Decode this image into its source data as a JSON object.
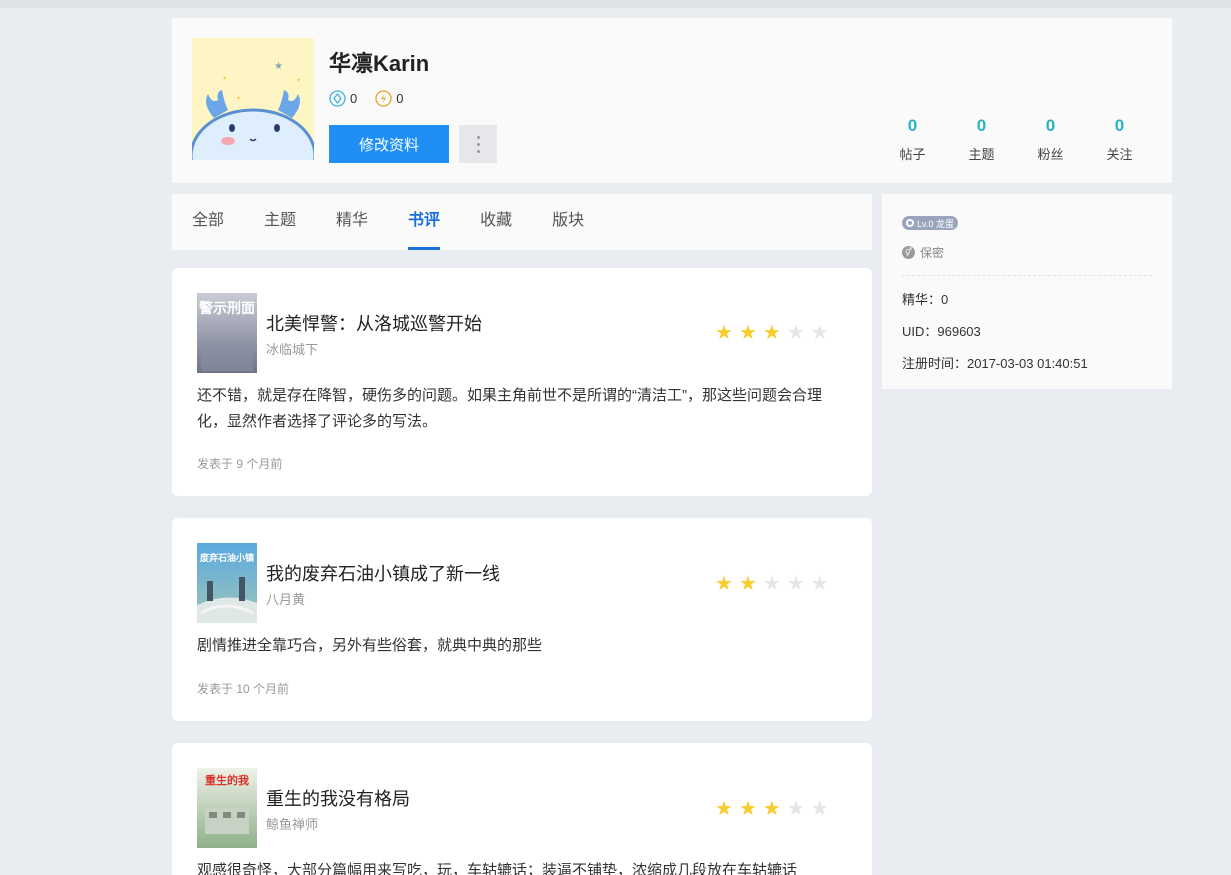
{
  "profile": {
    "username": "华凛Karin",
    "diamond_count": "0",
    "coin_count": "0",
    "edit_label": "修改资料",
    "stats": [
      {
        "num": "0",
        "label": "帖子"
      },
      {
        "num": "0",
        "label": "主题"
      },
      {
        "num": "0",
        "label": "粉丝"
      },
      {
        "num": "0",
        "label": "关注"
      }
    ]
  },
  "tabs": [
    {
      "label": "全部",
      "active": false
    },
    {
      "label": "主题",
      "active": false
    },
    {
      "label": "精华",
      "active": false
    },
    {
      "label": "书评",
      "active": true
    },
    {
      "label": "收藏",
      "active": false
    },
    {
      "label": "版块",
      "active": false
    }
  ],
  "side": {
    "level": "Lv.0 龙蛋",
    "gender": "保密",
    "essence": "精华：0",
    "uid": "UID：969603",
    "register": "注册时间：2017-03-03 01:40:51"
  },
  "reviews": [
    {
      "title": "北美悍警：从洛城巡警开始",
      "author": "冰临城下",
      "rating": 3,
      "max_rating": 5,
      "content": "还不错，就是存在降智，硬伤多的问题。如果主角前世不是所谓的“清洁工”，那这些问题会合理化，显然作者选择了评论多的写法。",
      "time": "发表于 9 个月前",
      "cover_text": "警示刑面"
    },
    {
      "title": "我的废弃石油小镇成了新一线",
      "author": "八月黄",
      "rating": 2,
      "max_rating": 5,
      "content": "剧情推进全靠巧合，另外有些俗套，就典中典的那些",
      "time": "发表于 10 个月前",
      "cover_text": "废弃石油小镇"
    },
    {
      "title": "重生的我没有格局",
      "author": "鲸鱼禅师",
      "rating": 3,
      "max_rating": 5,
      "content": "观感很奇怪，大部分篇幅用来写吃，玩，车轱辘话；装逼不铺垫，浓缩成几段放在车轱辘话",
      "time": "",
      "cover_text": "重生的我"
    }
  ],
  "colors": {
    "accent": "#1f8ff5",
    "tab_active": "#1a6fd8",
    "stat": "#2bb3c4",
    "star_on": "#f6cd2a",
    "star_off": "#e6e6e6"
  },
  "icons": {
    "diamond": "diamond-icon",
    "coin": "coin-icon",
    "more": "more-vertical-icon",
    "star": "star-icon",
    "gender": "gender-icon",
    "level": "gear-icon"
  }
}
